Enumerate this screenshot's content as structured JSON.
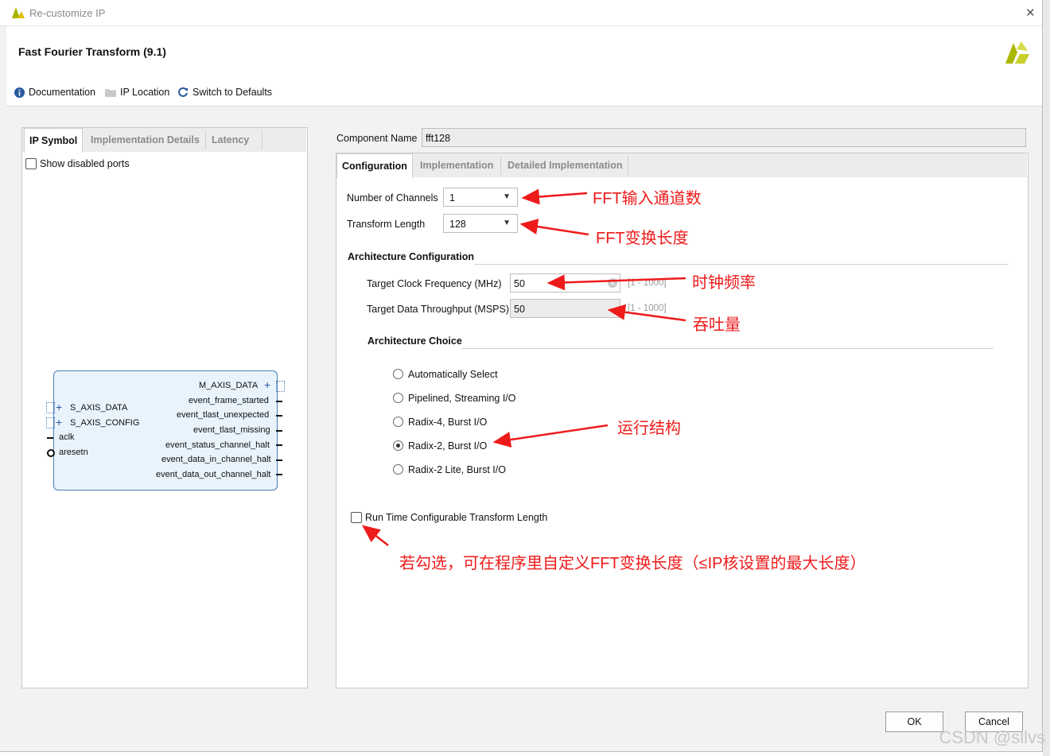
{
  "window": {
    "title": "Re-customize IP",
    "close_glyph": "✕"
  },
  "ip": {
    "title": "Fast Fourier Transform (9.1)"
  },
  "toolbar": {
    "documentation": "Documentation",
    "ip_location": "IP Location",
    "switch_defaults": "Switch to Defaults"
  },
  "left_tabs": [
    "IP Symbol",
    "Implementation Details",
    "Latency"
  ],
  "show_disabled_ports": "Show disabled ports",
  "symbol": {
    "left_ports": [
      "S_AXIS_DATA",
      "S_AXIS_CONFIG",
      "aclk",
      "aresetn"
    ],
    "right_ports": [
      "M_AXIS_DATA",
      "event_frame_started",
      "event_tlast_unexpected",
      "event_tlast_missing",
      "event_status_channel_halt",
      "event_data_in_channel_halt",
      "event_data_out_channel_halt"
    ]
  },
  "component_name": {
    "label": "Component Name",
    "value": "fft128"
  },
  "right_tabs": [
    "Configuration",
    "Implementation",
    "Detailed Implementation"
  ],
  "config": {
    "channels_label": "Number of Channels",
    "channels_value": "1",
    "transform_label": "Transform Length",
    "transform_value": "128",
    "arch_config": "Architecture Configuration",
    "clock_label": "Target Clock Frequency (MHz)",
    "clock_value": "50",
    "clock_range": "[1 - 1000]",
    "throughput_label": "Target Data Throughput (MSPS)",
    "throughput_value": "50",
    "throughput_range": "[1 - 1000]",
    "arch_choice": "Architecture Choice",
    "options": [
      "Automatically Select",
      "Pipelined, Streaming I/O",
      "Radix-4, Burst I/O",
      "Radix-2, Burst I/O",
      "Radix-2 Lite, Burst I/O"
    ],
    "selected_option": "Radix-2, Burst I/O",
    "runtime_label": "Run Time Configurable Transform Length"
  },
  "annotations": {
    "channels": "FFT输入通道数",
    "transform": "FFT变换长度",
    "clock": "时钟频率",
    "throughput": "吞吐量",
    "arch": "运行结构",
    "runtime": "若勾选，可在程序里自定义FFT变换长度（≤IP核设置的最大长度）"
  },
  "buttons": {
    "ok": "OK",
    "cancel": "Cancel"
  },
  "watermark": "CSDN @sllvs",
  "colors": {
    "annotation": "#ee1b1b",
    "symbol_fill": "#e8f3fc",
    "symbol_border": "#4a7fb5",
    "logo": "#b5c200"
  }
}
